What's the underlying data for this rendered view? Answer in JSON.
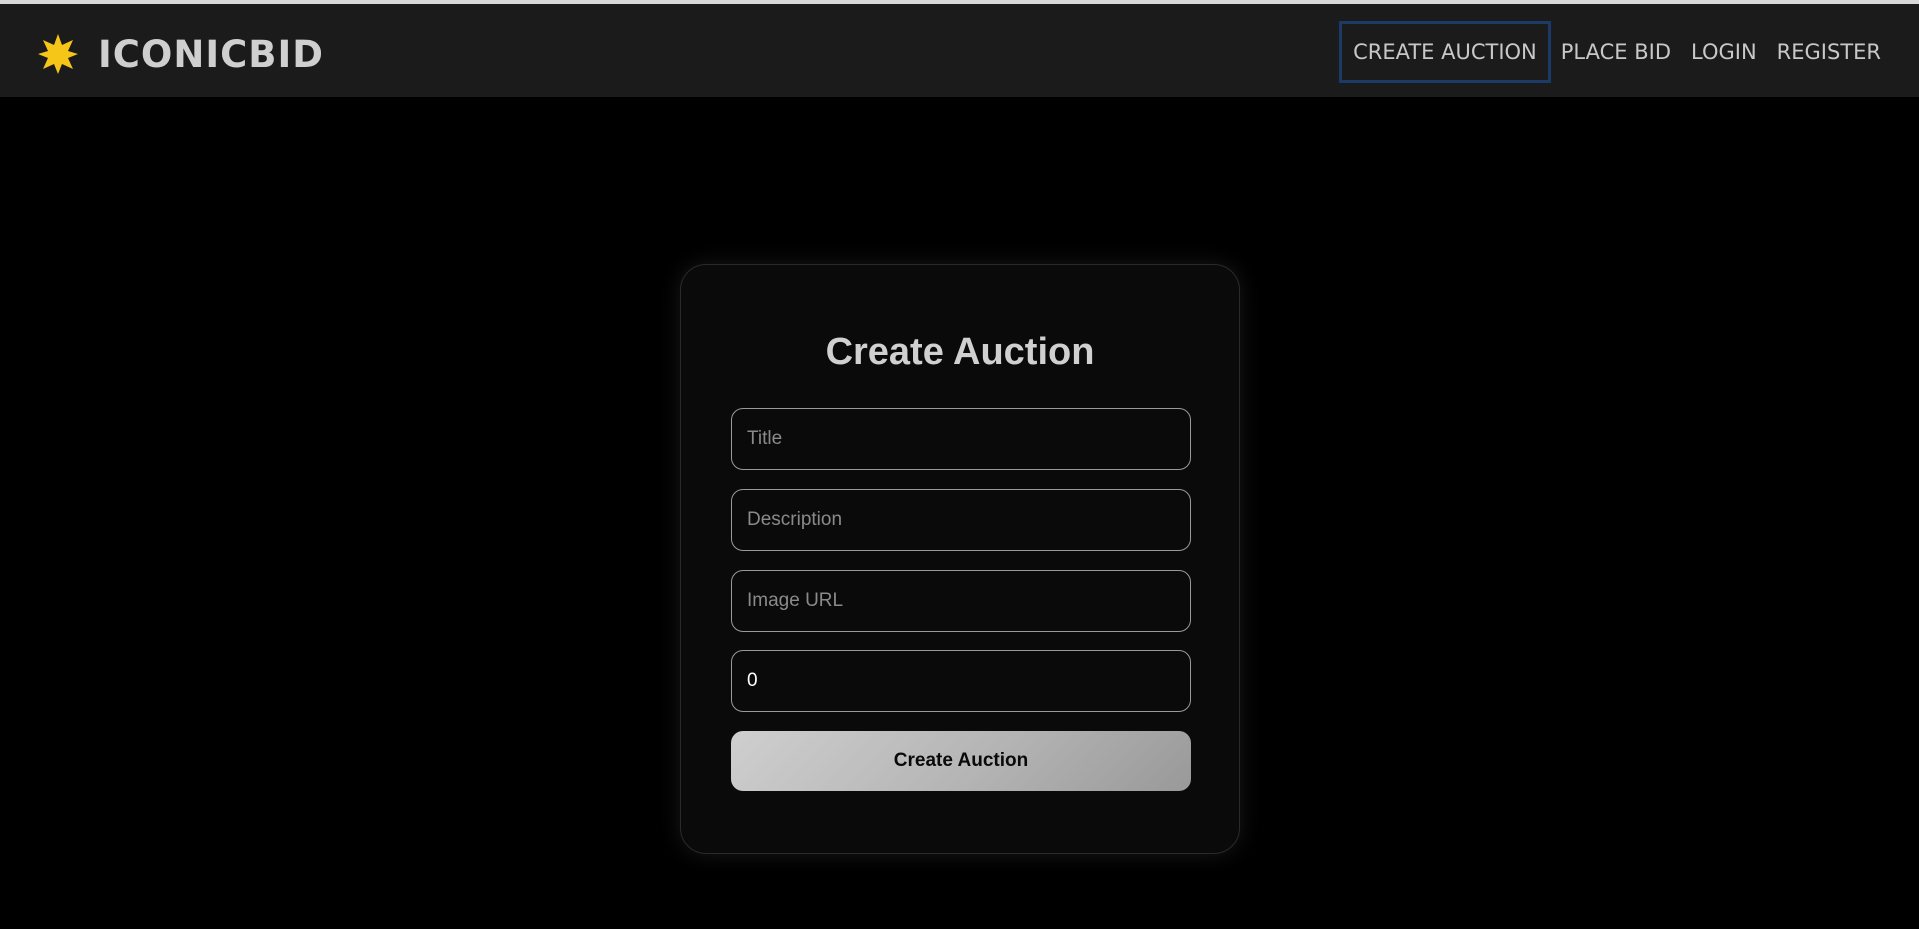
{
  "topline_color": "#d8d8d8",
  "navbar": {
    "brand": {
      "icon": "star-burst-icon",
      "icon_color": "#f5c518",
      "name": "ICONICBID"
    },
    "links": [
      {
        "label": "CREATE AUCTION",
        "active": true
      },
      {
        "label": "PLACE BID",
        "active": false
      },
      {
        "label": "LOGIN",
        "active": false
      },
      {
        "label": "REGISTER",
        "active": false
      }
    ]
  },
  "form": {
    "title": "Create Auction",
    "fields": {
      "title": {
        "placeholder": "Title",
        "value": ""
      },
      "description": {
        "placeholder": "Description",
        "value": ""
      },
      "image_url": {
        "placeholder": "Image URL",
        "value": ""
      },
      "starting_price": {
        "value": "0"
      }
    },
    "submit_label": "Create Auction"
  },
  "colors": {
    "background": "#000000",
    "navbar_bg": "#1b1b1b",
    "card_bg": "#0a0a0a",
    "active_link_border": "#1c3a66",
    "text_muted": "#c8c8c8"
  }
}
